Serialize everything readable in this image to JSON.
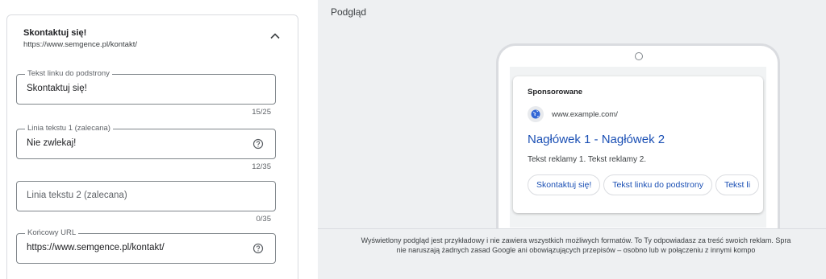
{
  "editor": {
    "title": "Skontaktuj się!",
    "url": "https://www.semgence.pl/kontakt/",
    "fields": [
      {
        "label": "Tekst linku do podstrony",
        "value": "Skontaktuj się!",
        "counter": "15/25"
      },
      {
        "label": "Linia tekstu 1 (zalecana)",
        "value": "Nie zwlekaj!",
        "counter": "12/35"
      },
      {
        "placeholder": "Linia tekstu 2 (zalecana)",
        "counter": "0/35"
      },
      {
        "label": "Końcowy URL",
        "value": "https://www.semgence.pl/kontakt/"
      }
    ]
  },
  "preview": {
    "title": "Podgląd",
    "ad": {
      "sponsored": "Sponsorowane",
      "domain": "www.example.com/",
      "headline": "Nagłówek 1 - Nagłówek 2",
      "description": "Tekst reklamy 1. Tekst reklamy 2.",
      "sitelinks": [
        "Skontaktuj się!",
        "Tekst linku do podstrony",
        "Tekst li"
      ]
    },
    "disclaimer_line1": "Wyświetlony podgląd jest przykładowy i nie zawiera wszystkich możliwych formatów. To Ty odpowiadasz za treść swoich reklam. Spra",
    "disclaimer_line2": "nie naruszają żadnych zasad Google ani obowiązujących przepisów – osobno lub w połączeniu z innymi kompo"
  },
  "colors": {
    "link_blue": "#1a4fb4",
    "border": "#80868b",
    "panel_bg": "#eef0f2"
  },
  "icons": [
    "chevron-up-icon",
    "help-icon",
    "globe-icon"
  ]
}
